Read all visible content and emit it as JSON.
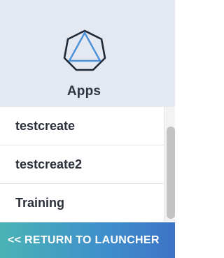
{
  "header": {
    "icon": "hexagon-triangle-icon",
    "title": "Apps",
    "icon_colors": {
      "outline": "#1f2a38",
      "triangle": "#4a90d9"
    }
  },
  "apps": {
    "items": [
      {
        "label": "testcreate"
      },
      {
        "label": "testcreate2"
      },
      {
        "label": "Training"
      }
    ]
  },
  "footer": {
    "return_label": "<< RETURN TO LAUNCHER",
    "gradient_start": "#4ab3b4",
    "gradient_end": "#3d73c6"
  }
}
